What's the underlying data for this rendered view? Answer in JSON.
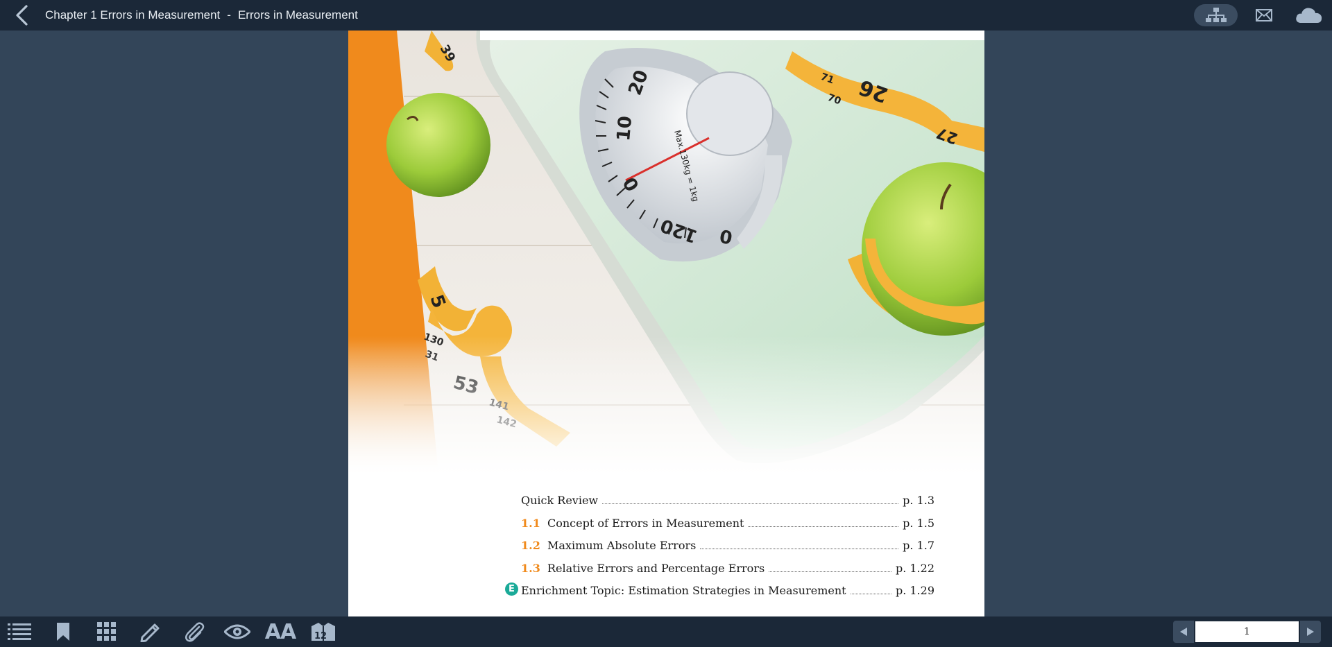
{
  "header": {
    "chapter_title": "Chapter 1 Errors in Measurement",
    "separator": "-",
    "section_title": "Errors in Measurement"
  },
  "toc": {
    "items": [
      {
        "number": "",
        "label": "Quick Review",
        "page": "p. 1.3"
      },
      {
        "number": "1.1",
        "label": "Concept of Errors in Measurement",
        "page": "p. 1.5"
      },
      {
        "number": "1.2",
        "label": "Maximum Absolute Errors",
        "page": "p. 1.7"
      },
      {
        "number": "1.3",
        "label": "Relative Errors and Percentage Errors",
        "page": "p. 1.22"
      },
      {
        "number": "",
        "badge": "E",
        "label": "Enrichment Topic: Estimation Strategies in Measurement",
        "page": "p. 1.29"
      }
    ]
  },
  "photo": {
    "dial_numbers": [
      "20",
      "10",
      "0",
      "120",
      "0"
    ],
    "dial_text": "Max.130kg = 1kg",
    "tape_numbers": [
      "39",
      "71",
      "70",
      "26",
      "27",
      "5",
      "130",
      "31",
      "53",
      "141",
      "142"
    ]
  },
  "footer": {
    "tools": [
      "toc-icon",
      "bookmark-icon",
      "grid-icon",
      "pencil-icon",
      "paperclip-icon",
      "eye-icon",
      "font-size-icon",
      "page-layout-icon"
    ],
    "font_label": "AA",
    "layout_label": "12",
    "page_number": "1"
  },
  "colors": {
    "topbar": "#1b2838",
    "background": "#334559",
    "accent_orange": "#f08a1c",
    "enrichment_teal": "#1aaa98",
    "icon": "#a7b8cb"
  }
}
